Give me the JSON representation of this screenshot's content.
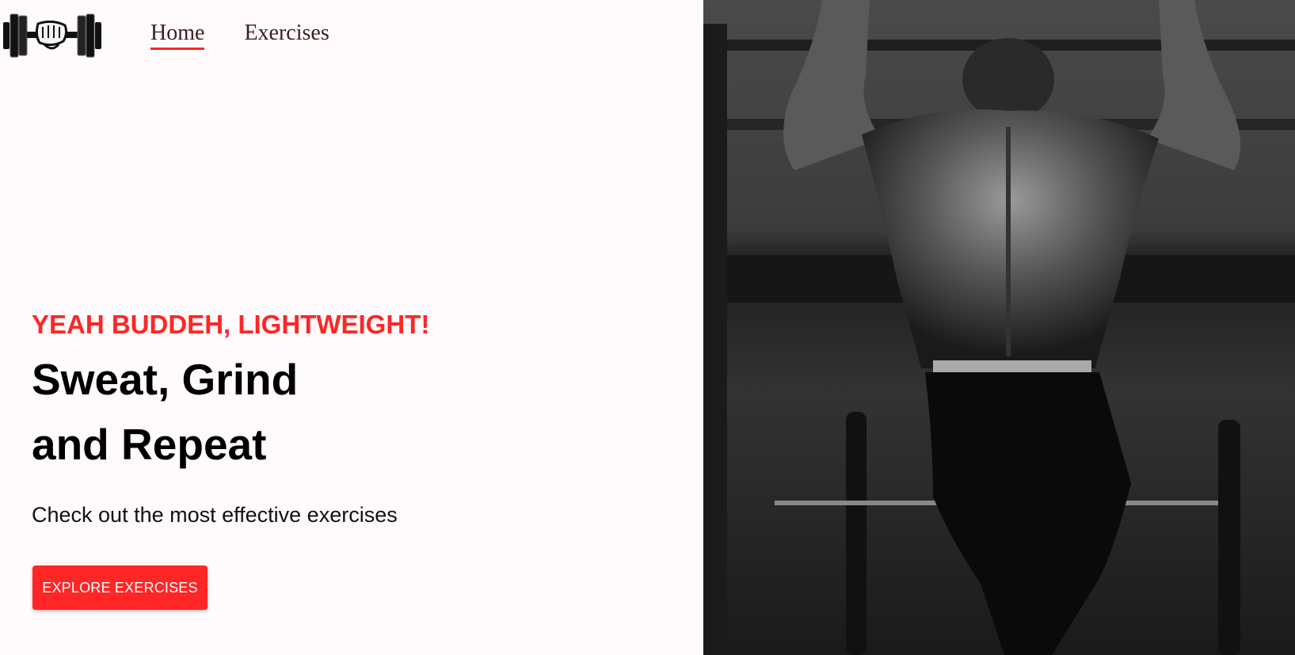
{
  "header": {
    "logo_icon": "dumbbell-fist-icon",
    "nav": [
      {
        "label": "Home",
        "active": true
      },
      {
        "label": "Exercises",
        "active": false
      }
    ]
  },
  "hero": {
    "tagline": "YEAH BUDDEH, LIGHTWEIGHT!",
    "headline_line1": "Sweat, Grind",
    "headline_line2": "and Repeat",
    "subtext": "Check out the most effective exercises",
    "cta_label": "EXPLORE EXERCISES"
  },
  "banner": {
    "description_icon": "athlete-pullup-photo"
  },
  "colors": {
    "accent": "#ff2625",
    "background": "#fffafb",
    "nav_text": "#3a1d1d"
  }
}
